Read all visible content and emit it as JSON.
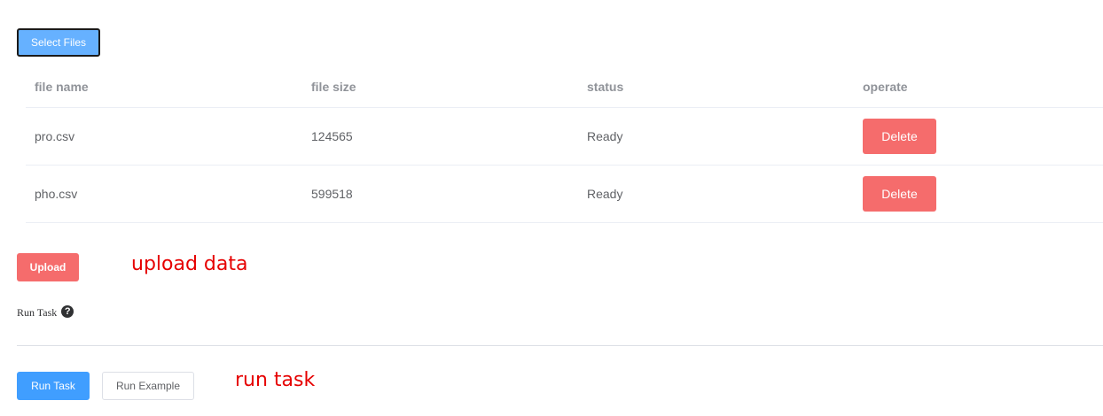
{
  "upload_panel": {
    "select_files_label": "Select Files",
    "columns": [
      "file name",
      "file size",
      "status",
      "operate"
    ],
    "files": [
      {
        "name": "pro.csv",
        "size": "124565",
        "status": "Ready",
        "action": "Delete"
      },
      {
        "name": "pho.csv",
        "size": "599518",
        "status": "Ready",
        "action": "Delete"
      }
    ],
    "upload_label": "Upload",
    "upload_annotation": "upload data"
  },
  "run_panel": {
    "label": "Run Task",
    "help_icon": "question-circle-icon",
    "run_task_label": "Run Task",
    "run_example_label": "Run Example",
    "run_annotation": "run task"
  },
  "colors": {
    "primary": "#409eff",
    "primary_light": "#66b1ff",
    "danger": "#f56c6c",
    "annotation": "#e60000"
  }
}
